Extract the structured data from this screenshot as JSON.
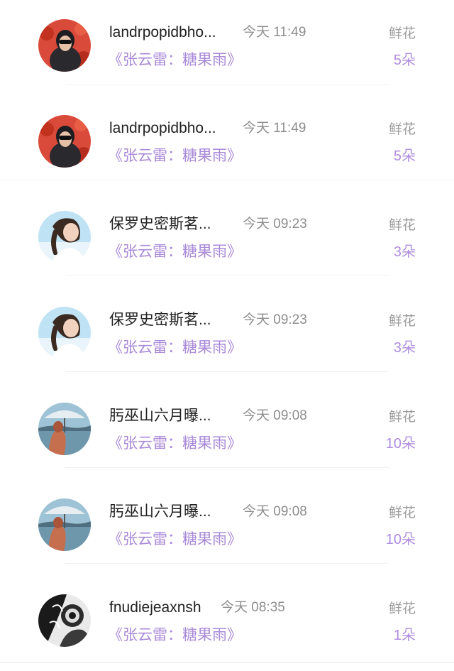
{
  "gifts": [
    {
      "name": "landrpopidbho...",
      "time": "今天 11:49",
      "book": "《张云雷：糖果雨》",
      "gift_type": "鲜花",
      "count": "5朵",
      "avatar": "woman-sunglasses-red-background"
    },
    {
      "name": "landrpopidbho...",
      "time": "今天 11:49",
      "book": "《张云雷：糖果雨》",
      "gift_type": "鲜花",
      "count": "5朵",
      "avatar": "woman-sunglasses-red-background"
    },
    {
      "name": "保罗史密斯茗...",
      "time": "今天 09:23",
      "book": "《张云雷：糖果雨》",
      "gift_type": "鲜花",
      "count": "3朵",
      "avatar": "girl-braid-profile"
    },
    {
      "name": "保罗史密斯茗...",
      "time": "今天 09:23",
      "book": "《张云雷：糖果雨》",
      "gift_type": "鲜花",
      "count": "3朵",
      "avatar": "girl-braid-profile"
    },
    {
      "name": "肟巫山六月曝...",
      "time": "今天 09:08",
      "book": "《张云雷：糖果雨》",
      "gift_type": "鲜花",
      "count": "10朵",
      "avatar": "umbrella-lake-scene"
    },
    {
      "name": "肟巫山六月曝...",
      "time": "今天 09:08",
      "book": "《张云雷：糖果雨》",
      "gift_type": "鲜花",
      "count": "10朵",
      "avatar": "umbrella-lake-scene"
    },
    {
      "name": "fnudiejeaxnsh",
      "time": "今天 08:35",
      "book": "《张云雷：糖果雨》",
      "gift_type": "鲜花",
      "count": "1朵",
      "avatar": "black-white-mask-art"
    }
  ],
  "colors": {
    "accent": "#a98ad8",
    "name": "#222222",
    "muted": "#8d8d8d"
  }
}
